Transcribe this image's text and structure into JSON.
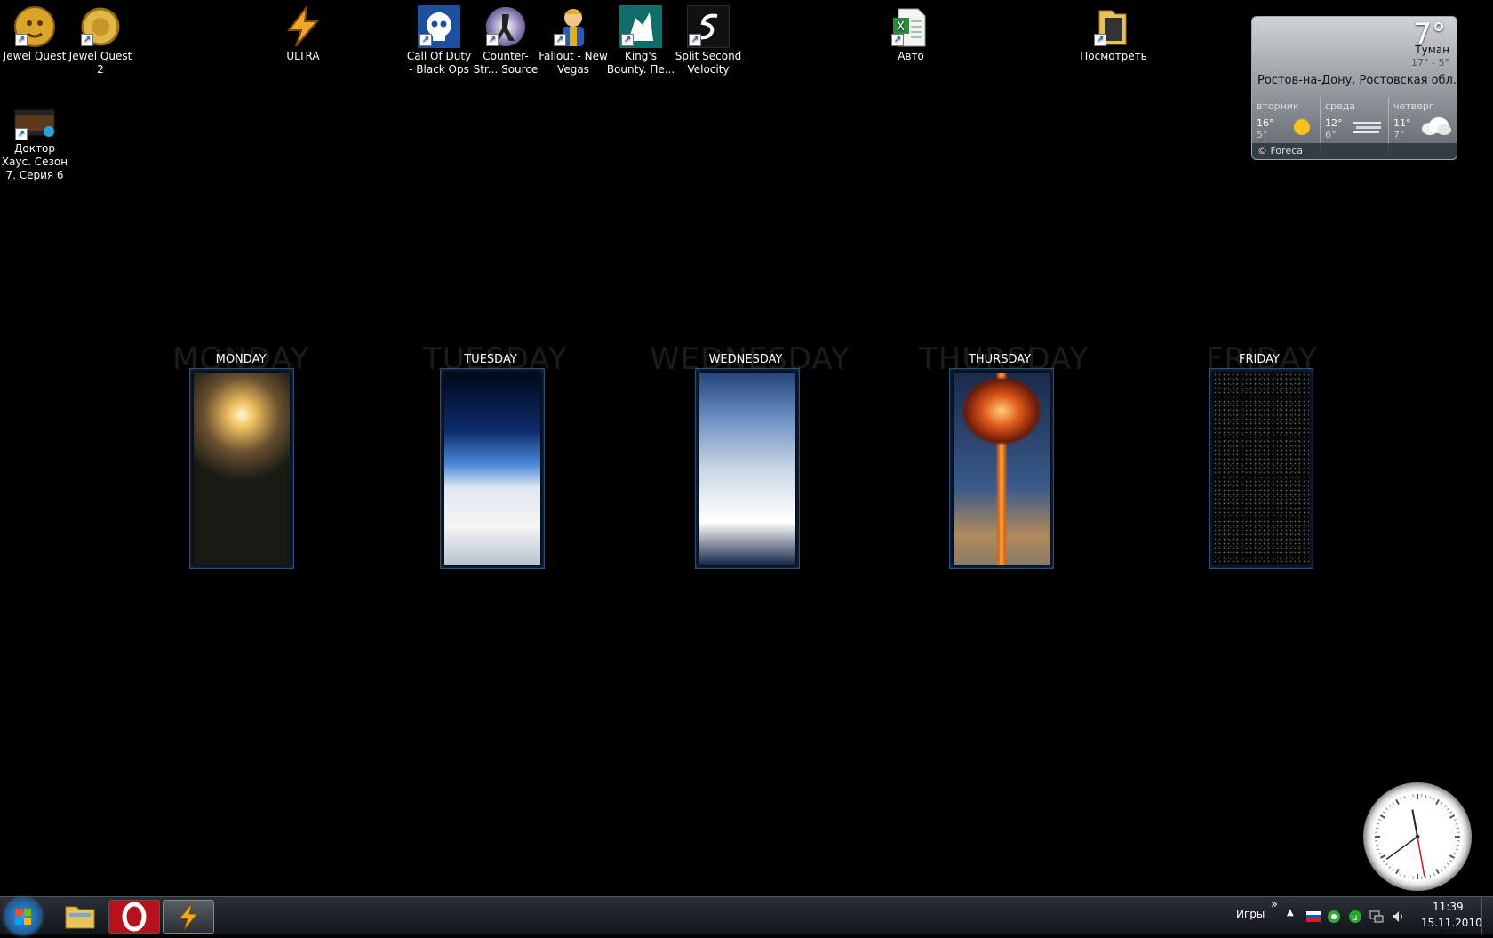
{
  "desktop": {
    "icons": [
      {
        "label": "Jewel Quest",
        "icon": "jewel-quest-icon"
      },
      {
        "label": "Jewel Quest 2",
        "icon": "jewel-quest-2-icon"
      },
      {
        "label": "ULTRA",
        "icon": "winamp-icon"
      },
      {
        "label": "Call Of Duty - Black Ops",
        "icon": "call-of-duty-icon"
      },
      {
        "label": "Counter-Str... Source",
        "icon": "counter-strike-icon"
      },
      {
        "label": "Fallout - New Vegas",
        "icon": "fallout-icon"
      },
      {
        "label": "King's Bounty. Пе...",
        "icon": "kings-bounty-icon"
      },
      {
        "label": "Split Second Velocity",
        "icon": "split-second-icon"
      },
      {
        "label": "Авто",
        "icon": "excel-file-icon"
      },
      {
        "label": "Посмотреть",
        "icon": "folder-icon"
      },
      {
        "label": "Доктор Хаус. Сезон 7. Серия 6",
        "icon": "video-file-icon"
      }
    ]
  },
  "weather": {
    "temp": "7°",
    "condition": "Туман",
    "range": "17° - 5°",
    "city": "Ростов-на-Дону, Ростовская обл...",
    "days": [
      {
        "name": "вторник",
        "hi": "16°",
        "lo": "5°",
        "icon": "sun-icon"
      },
      {
        "name": "среда",
        "hi": "12°",
        "lo": "6°",
        "icon": "fog-icon"
      },
      {
        "name": "четверг",
        "hi": "11°",
        "lo": "7°",
        "icon": "cloud-icon"
      }
    ],
    "credit": "© Foreca"
  },
  "weekdays": [
    {
      "title": "MONDAY",
      "ghost": "MONDAY"
    },
    {
      "title": "TUESDAY",
      "ghost": "TUESDAY"
    },
    {
      "title": "WEDNESDAY",
      "ghost": "WEDNESDAY"
    },
    {
      "title": "THURSDAY",
      "ghost": "THURSDAY"
    },
    {
      "title": "FRIDAY",
      "ghost": "FRIDAY"
    }
  ],
  "clock": {
    "hour": 11,
    "minute": 39
  },
  "taskbar": {
    "pinned": [
      "explorer-icon",
      "opera-icon",
      "winamp-icon"
    ],
    "toolbar_label": "Игры",
    "chevron": "»",
    "time": "11:39",
    "date": "15.11.2010"
  }
}
